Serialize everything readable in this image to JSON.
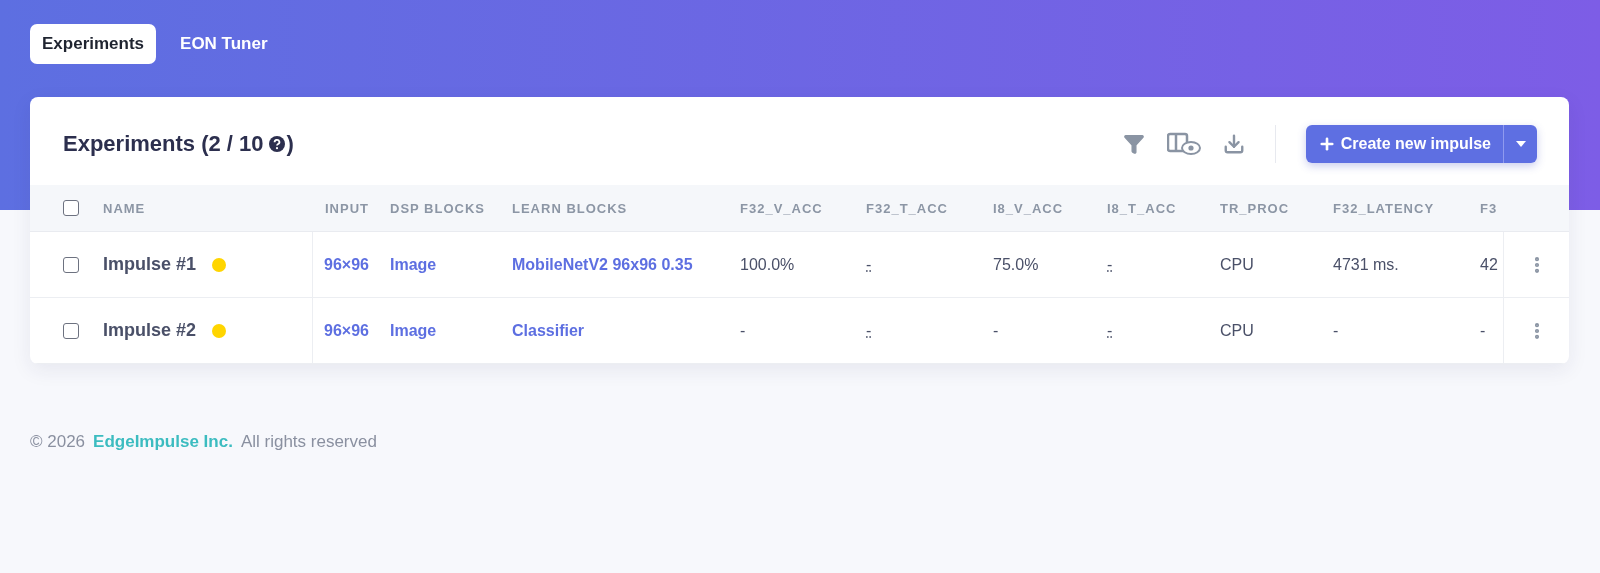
{
  "tabs": [
    {
      "label": "Experiments",
      "selected": true
    },
    {
      "label": "EON Tuner",
      "selected": false
    }
  ],
  "card": {
    "title": "Experiments (2 / 10",
    "title_end": ")",
    "create_button": "Create new impulse"
  },
  "table": {
    "columns": [
      "NAME",
      "INPUT",
      "DSP BLOCKS",
      "LEARN BLOCKS",
      "F32_V_ACC",
      "F32_T_ACC",
      "I8_V_ACC",
      "I8_T_ACC",
      "TR_PROC",
      "F32_LATENCY",
      "F3"
    ],
    "header_checked": false,
    "rows": [
      {
        "checked": false,
        "cells": [
          {
            "text": "Impulse #1",
            "kind": "name",
            "color": "#ffd500"
          },
          {
            "text": "96×96",
            "kind": "link"
          },
          {
            "text": "Image",
            "kind": "link"
          },
          {
            "text": "MobileNetV2 96x96 0.35",
            "kind": "link"
          },
          {
            "text": "100.0%",
            "kind": "text"
          },
          {
            "text": "-",
            "kind": "hint"
          },
          {
            "text": "75.0%",
            "kind": "text"
          },
          {
            "text": "-",
            "kind": "hint"
          },
          {
            "text": "CPU",
            "kind": "text"
          },
          {
            "text": "4731 ms.",
            "kind": "text"
          },
          {
            "text": "42",
            "kind": "text"
          }
        ]
      },
      {
        "checked": false,
        "cells": [
          {
            "text": "Impulse #2",
            "kind": "name",
            "color": "#ffd500"
          },
          {
            "text": "96×96",
            "kind": "link"
          },
          {
            "text": "Image",
            "kind": "link"
          },
          {
            "text": "Classifier",
            "kind": "link"
          },
          {
            "text": "-",
            "kind": "text"
          },
          {
            "text": "-",
            "kind": "hint"
          },
          {
            "text": "-",
            "kind": "text"
          },
          {
            "text": "-",
            "kind": "hint"
          },
          {
            "text": "CPU",
            "kind": "text"
          },
          {
            "text": "-",
            "kind": "text"
          },
          {
            "text": "-",
            "kind": "text"
          }
        ]
      }
    ]
  },
  "footer": {
    "copyright": "© 2026",
    "company": "EdgeImpulse Inc.",
    "rest": "All rights reserved"
  }
}
